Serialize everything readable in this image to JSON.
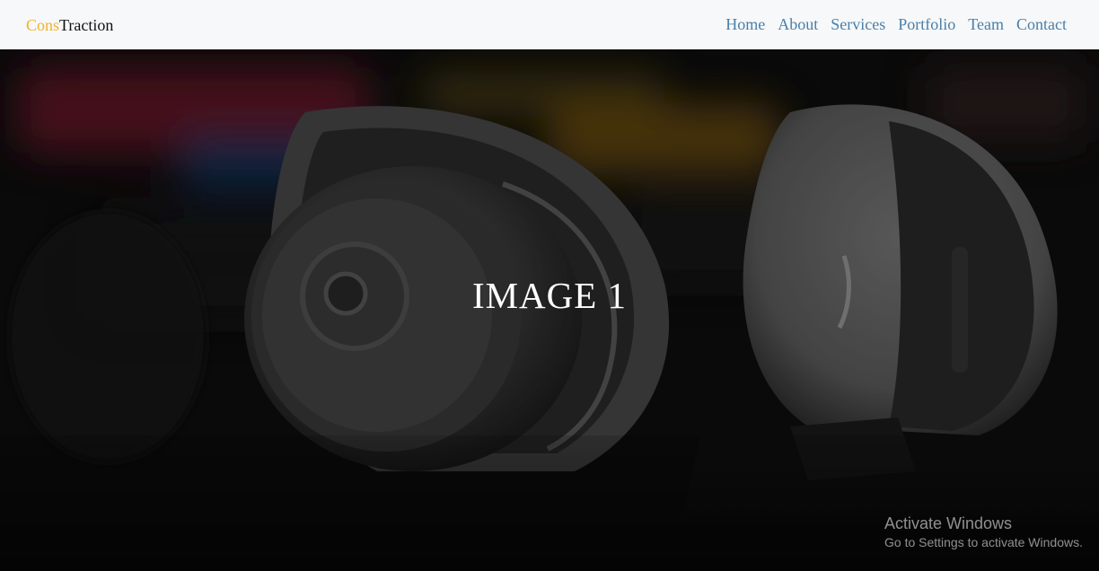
{
  "navbar": {
    "brand_accent": "Cons",
    "brand_main": "Traction",
    "links": [
      "Home",
      "About",
      "Services",
      "Portfolio",
      "Team",
      "Contact"
    ]
  },
  "hero": {
    "title": "IMAGE 1",
    "image": "headphones-photo"
  },
  "watermark": {
    "title": "Activate Windows",
    "subtitle": "Go to Settings to activate Windows."
  },
  "colors": {
    "brand_accent": "#f4b223",
    "nav_link": "#4a7fa8",
    "navbar_bg": "#f6f8fa"
  }
}
